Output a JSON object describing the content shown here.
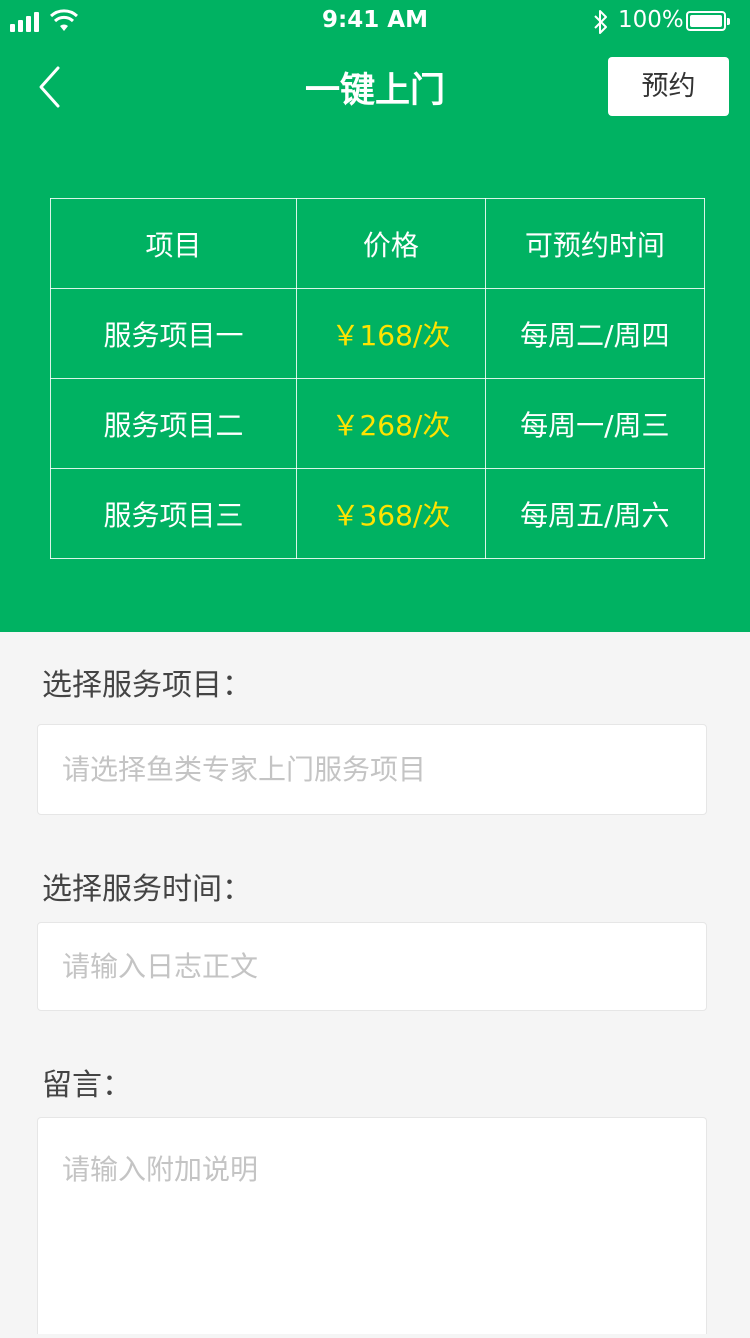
{
  "status_bar": {
    "time": "9:41 AM",
    "battery": "100%",
    "icons": [
      "signal-icon",
      "wifi-icon",
      "bluetooth-icon",
      "battery-icon"
    ]
  },
  "nav": {
    "title": "一键上门",
    "back_icon": "chevron-left-icon",
    "reserve_label": "预约"
  },
  "colors": {
    "brand_green": "#00b262",
    "price_yellow": "#ffe300",
    "background": "#f5f5f5"
  },
  "table": {
    "headers": [
      "项目",
      "价格",
      "可预约时间"
    ],
    "rows": [
      {
        "name": "服务项目一",
        "price": "￥168/次",
        "time": "每周二/周四"
      },
      {
        "name": "服务项目二",
        "price": "￥268/次",
        "time": "每周一/周三"
      },
      {
        "name": "服务项目三",
        "price": "￥368/次",
        "time": "每周五/周六"
      }
    ]
  },
  "form": {
    "service_label": "选择服务项目：",
    "service_placeholder": "请选择鱼类专家上门服务项目",
    "time_label": "选择服务时间：",
    "time_placeholder": "请输入日志正文",
    "message_label": "留言：",
    "message_placeholder": "请输入附加说明"
  }
}
